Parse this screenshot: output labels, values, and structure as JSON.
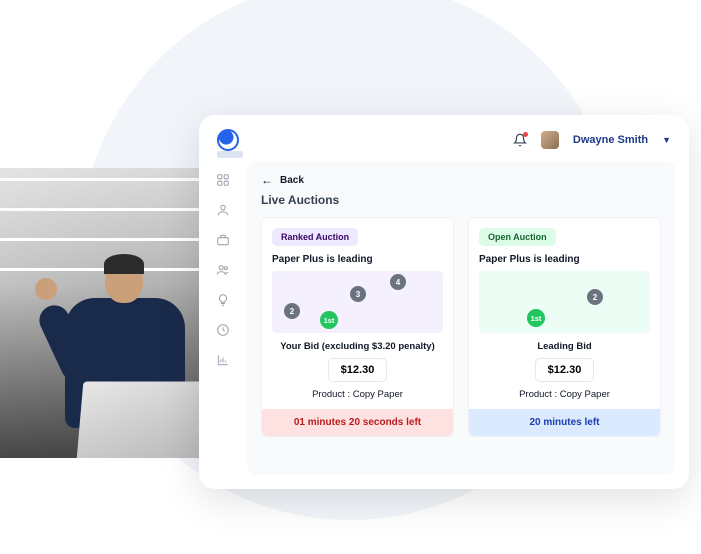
{
  "header": {
    "username": "Dwayne Smith"
  },
  "back": {
    "label": "Back"
  },
  "page_title": "Live Auctions",
  "cards": [
    {
      "badge": "Ranked Auction",
      "leading": "Paper Plus is leading",
      "bubbles": {
        "b2": "2",
        "b3": "3",
        "b4": "4",
        "first": "1st"
      },
      "bid_label": "Your Bid (excluding $3.20 penalty)",
      "price": "$12.30",
      "product": "Product : Copy Paper",
      "time": "01 minutes 20 seconds left"
    },
    {
      "badge": "Open Auction",
      "leading": "Paper Plus is leading",
      "bubbles": {
        "b2": "2",
        "first": "1st"
      },
      "bid_label": "Leading Bid",
      "price": "$12.30",
      "product": "Product : Copy Paper",
      "time": "20 minutes left"
    }
  ]
}
